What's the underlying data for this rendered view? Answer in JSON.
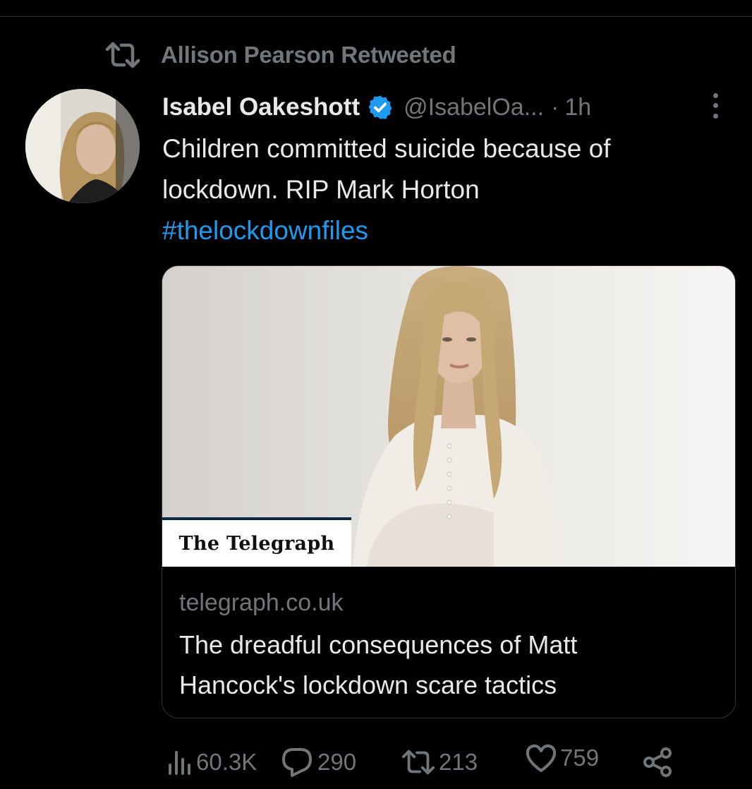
{
  "retweet": {
    "label": "Allison Pearson Retweeted",
    "icon": "retweet-icon"
  },
  "tweet": {
    "author": {
      "name": "Isabel Oakeshott",
      "handle": "@IsabelOa...",
      "verified": true,
      "avatar_icon": "profile-photo"
    },
    "separator": "·",
    "time": "1h",
    "more_icon": "more-vertical-icon",
    "text_lines": [
      "Children committed suicide because of",
      "lockdown. RIP Mark Horton"
    ],
    "hashtag": "#thelockdownfiles"
  },
  "card": {
    "source_badge": "The Telegraph",
    "domain": "telegraph.co.uk",
    "title_lines": [
      "The dreadful consequences of Matt",
      "Hancock's lockdown scare tactics"
    ]
  },
  "actions": {
    "views": {
      "icon": "analytics-icon",
      "count": "60.3K"
    },
    "replies": {
      "icon": "reply-icon",
      "count": "290"
    },
    "retweets": {
      "icon": "retweet-icon",
      "count": "213"
    },
    "likes": {
      "icon": "heart-icon",
      "count": "759"
    },
    "share": {
      "icon": "share-icon"
    }
  },
  "colors": {
    "background": "#000000",
    "text_primary": "#e7e9ea",
    "text_secondary": "#71767b",
    "link": "#1d9bf0",
    "verified": "#1d9bf0",
    "border": "#2f3336"
  }
}
